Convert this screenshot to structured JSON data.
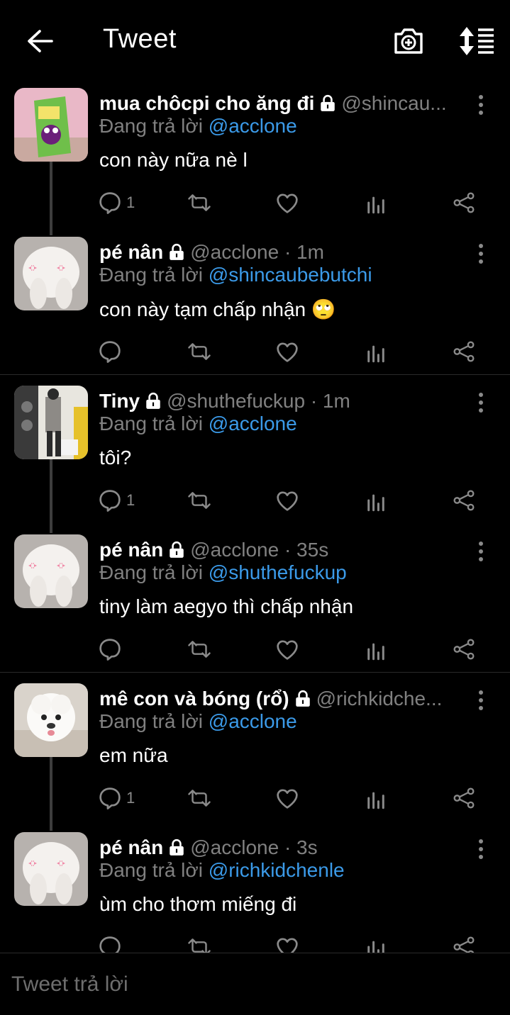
{
  "header": {
    "title": "Tweet"
  },
  "compose": {
    "placeholder": "Tweet trả lời"
  },
  "colors": {
    "background": "#000000",
    "mention": "#3b9ae8",
    "secondary_text": "#808080",
    "icon": "#8a8a8a"
  },
  "tweets": [
    {
      "name": "mua chôcpi cho ăng đi",
      "handle": "@shincau...",
      "reply_prefix": "Đang trả lời",
      "reply_to": "@acclone",
      "text": "con này nữa nè l",
      "reply_count": "1",
      "avatar": "juice-box-cartoon"
    },
    {
      "name": "pé nân",
      "handle": "@acclone · 1m",
      "reply_prefix": "Đang trả lời",
      "reply_to": "@shincaubebutchi",
      "text": "con này tạm chấp nhận 🙄",
      "reply_count": "",
      "avatar": "white-bunny"
    },
    {
      "name": "Tiny",
      "handle": "@shuthefuckup · 1m",
      "reply_prefix": "Đang trả lời",
      "reply_to": "@acclone",
      "text": "tôi?",
      "reply_count": "1",
      "avatar": "person-photo"
    },
    {
      "name": "pé nân",
      "handle": "@acclone · 35s",
      "reply_prefix": "Đang trả lời",
      "reply_to": "@shuthefuckup",
      "text": "tiny làm aegyo thì chấp nhận",
      "reply_count": "",
      "avatar": "white-bunny"
    },
    {
      "name": "mê con và bóng (rổ)",
      "handle": "@richkidche...",
      "reply_prefix": "Đang trả lời",
      "reply_to": "@acclone",
      "text": "em nữa",
      "reply_count": "1",
      "avatar": "white-dog"
    },
    {
      "name": "pé nân",
      "handle": "@acclone · 3s",
      "reply_prefix": "Đang trả lời",
      "reply_to": "@richkidchenle",
      "text": "ùm cho thơm miếng đi",
      "reply_count": "",
      "avatar": "white-bunny"
    }
  ]
}
